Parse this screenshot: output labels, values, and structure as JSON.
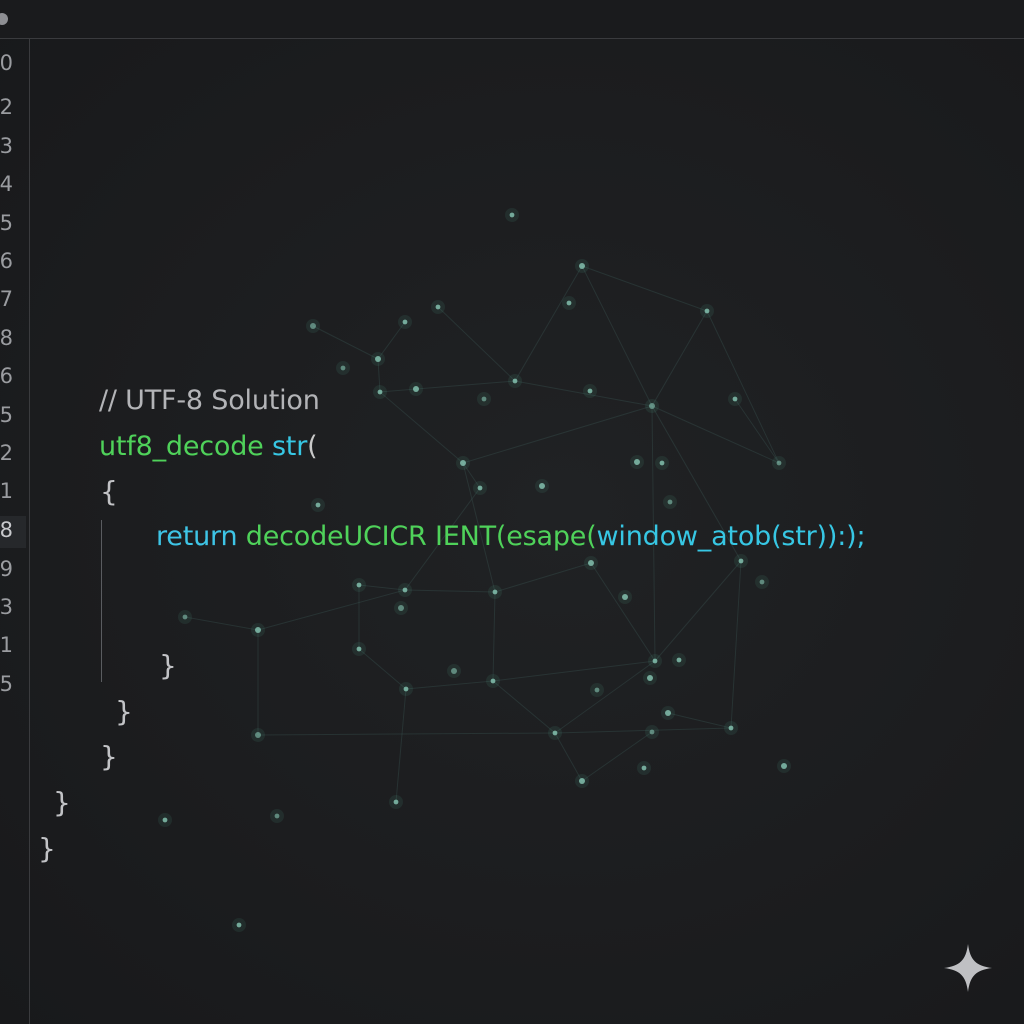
{
  "gutter": {
    "line_numbers": [
      "0",
      "2",
      "3",
      "4",
      "5",
      "6",
      "7",
      "8",
      "6",
      "5",
      "2",
      "1",
      "8",
      "9",
      "3",
      "1",
      "5"
    ]
  },
  "code": {
    "comment": "// UTF-8 Solution",
    "fn_name": "utf8_decode",
    "fn_param": "str",
    "fn_paren": "(",
    "open_brace": "{",
    "return_keyword": "return",
    "decode_call": "decodeUCICR IENT(",
    "esape_call": "esape(",
    "window_atob": "window_atob(str)):);",
    "closing_braces": [
      "}",
      "}",
      "}",
      "}",
      "}"
    ]
  },
  "colors": {
    "background": "#1c1d1f",
    "green": "#4fd25a",
    "cyan": "#37c7e4",
    "comment": "#b3b4b7"
  },
  "icons": {
    "bottom_right": "sparkle-icon",
    "top_left": "dot-icon"
  }
}
